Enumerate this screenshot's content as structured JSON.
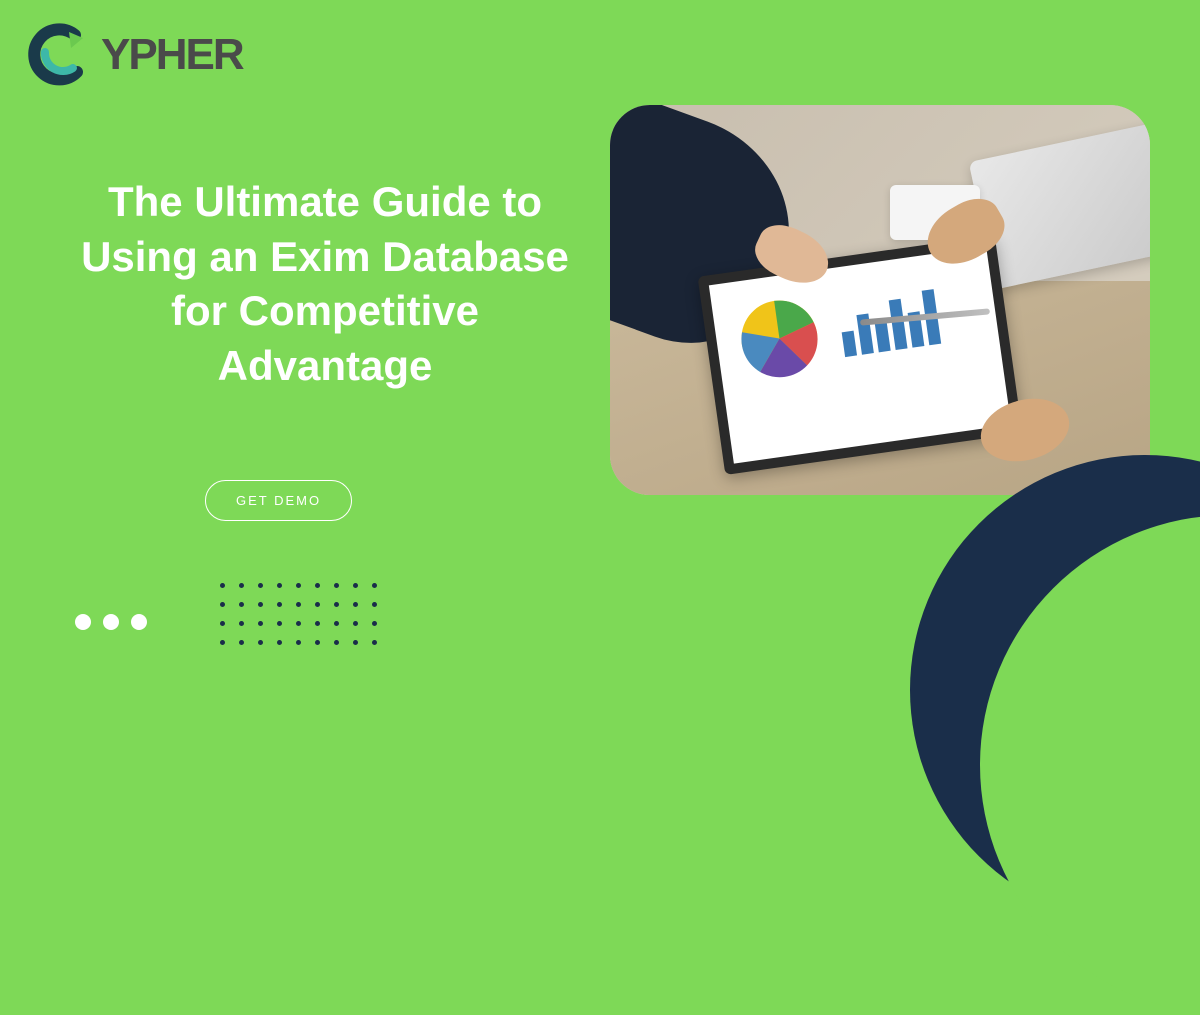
{
  "logo": {
    "brand": "CYPHER",
    "letter_c": "C",
    "letters_rest": "YPHER"
  },
  "headline": "The Ultimate Guide to Using an Exim Database for Competitive Advantage",
  "cta_label": "GET DEMO",
  "colors": {
    "background": "#7ed957",
    "navy": "#1a2e4a",
    "white": "#ffffff"
  }
}
